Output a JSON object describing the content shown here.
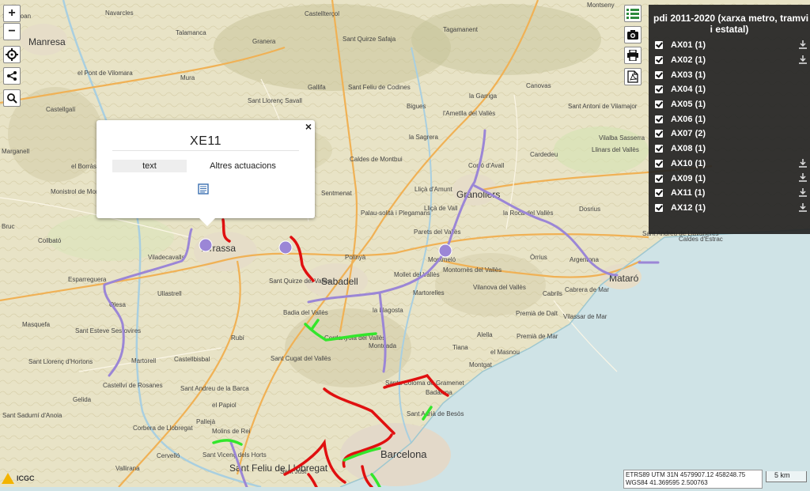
{
  "zoom": {
    "in_label": "+",
    "out_label": "−"
  },
  "panel": {
    "title_line1": "pdi 2011-2020 (xarxa metro, tramvi",
    "title_line2": "i estatal)",
    "layers": [
      {
        "label": "AX01 (1)",
        "download": true
      },
      {
        "label": "AX02 (1)",
        "download": true
      },
      {
        "label": "AX03 (1)",
        "download": false
      },
      {
        "label": "AX04 (1)",
        "download": false
      },
      {
        "label": "AX05 (1)",
        "download": false
      },
      {
        "label": "AX06 (1)",
        "download": false
      },
      {
        "label": "AX07 (2)",
        "download": false
      },
      {
        "label": "AX08 (1)",
        "download": false
      },
      {
        "label": "AX10 (1)",
        "download": true
      },
      {
        "label": "AX09 (1)",
        "download": true
      },
      {
        "label": "AX11 (1)",
        "download": true
      },
      {
        "label": "AX12 (1)",
        "download": true
      }
    ]
  },
  "popup": {
    "title": "XE11",
    "close": "×",
    "tab_text": "text",
    "tab_other": "Altres actuacions"
  },
  "coords": {
    "line1": "ETRS89 UTM 31N 4579907.12 458248.75",
    "line2": "WGS84 41.369595 2.500763"
  },
  "scale": "5 km",
  "logo": "ICGC",
  "colors": {
    "purple": "#9b86d6",
    "red": "#e01010",
    "green": "#33e62c",
    "sea": "#cfe3e6",
    "land": "#e9e4c7"
  },
  "places": [
    {
      "name": "Sant Joan"
    },
    {
      "name": "Manresa"
    },
    {
      "name": "Navarcles"
    },
    {
      "name": "Talamanca"
    },
    {
      "name": "Granera"
    },
    {
      "name": "Castellterçol"
    },
    {
      "name": "Sant Quirze Safaja"
    },
    {
      "name": "Tagamanent"
    },
    {
      "name": "Montseny"
    },
    {
      "name": "el Pont de Vilomara"
    },
    {
      "name": "Mura"
    },
    {
      "name": "Gallifa"
    },
    {
      "name": "Sant Feliu de Codines"
    },
    {
      "name": "Canovas"
    },
    {
      "name": "Castellgalí"
    },
    {
      "name": "Sant Llorenç Savall"
    },
    {
      "name": "Bigues"
    },
    {
      "name": "l'Ametlla del Vallès"
    },
    {
      "name": "la Garriga"
    },
    {
      "name": "Sant Antoni de Vilamajor"
    },
    {
      "name": "Marganell"
    },
    {
      "name": "Caldes de Montbui"
    },
    {
      "name": "la Sagrera"
    },
    {
      "name": "Cardedeu"
    },
    {
      "name": "Llinars del Vallès"
    },
    {
      "name": "Vilalba Sasserra"
    },
    {
      "name": "el Borràs"
    },
    {
      "name": "Monistrol de Montserrat"
    },
    {
      "name": "Sentmenat"
    },
    {
      "name": "Lliçà d'Amunt"
    },
    {
      "name": "Corró d'Avall"
    },
    {
      "name": "Granollers"
    },
    {
      "name": "Palau-solità i Plegamans"
    },
    {
      "name": "Lliçà de Vall"
    },
    {
      "name": "la Roca del Vallès"
    },
    {
      "name": "Dosrius"
    },
    {
      "name": "Bruc"
    },
    {
      "name": "Collbató"
    },
    {
      "name": "Parets del Vallès"
    },
    {
      "name": "Sant Andreu de Llavaneres"
    },
    {
      "name": "Caldes d'Estrac"
    },
    {
      "name": "Viladecavalls"
    },
    {
      "name": "Terrassa"
    },
    {
      "name": "Polinyà"
    },
    {
      "name": "Montmeló"
    },
    {
      "name": "Montornès del Vallès"
    },
    {
      "name": "Òrrius"
    },
    {
      "name": "Argentona"
    },
    {
      "name": "Mataró"
    },
    {
      "name": "Esparreguera"
    },
    {
      "name": "Sant Quirze del Vallès"
    },
    {
      "name": "Sabadell"
    },
    {
      "name": "Mollet del Vallès"
    },
    {
      "name": "Vilanova del Vallès"
    },
    {
      "name": "Ullastrell"
    },
    {
      "name": "Olesa"
    },
    {
      "name": "Martorelles"
    },
    {
      "name": "Cabrils"
    },
    {
      "name": "Cabrera de Mar"
    },
    {
      "name": "Badia del Vallès"
    },
    {
      "name": "la Llagosta"
    },
    {
      "name": "Premià de Dalt"
    },
    {
      "name": "Vilassar de Mar"
    },
    {
      "name": "Masquefa"
    },
    {
      "name": "Sant Esteve Sesrovires"
    },
    {
      "name": "Rubí"
    },
    {
      "name": "Cerdanyola del Vallès"
    },
    {
      "name": "Montcada"
    },
    {
      "name": "Alella"
    },
    {
      "name": "Premià de Mar"
    },
    {
      "name": "Tiana"
    },
    {
      "name": "el Masnou"
    },
    {
      "name": "Sant Llorenç d'Hortons"
    },
    {
      "name": "Martorell"
    },
    {
      "name": "Castellbisbal"
    },
    {
      "name": "Sant Cugat del Vallès"
    },
    {
      "name": "Montgat"
    },
    {
      "name": "Castellví de Rosanes"
    },
    {
      "name": "Sant Andreu de la Barca"
    },
    {
      "name": "Santa Coloma de Gramenet"
    },
    {
      "name": "Badalona"
    },
    {
      "name": "Gelida"
    },
    {
      "name": "el Papiol"
    },
    {
      "name": "Sant Adrià de Besòs"
    },
    {
      "name": "Sant Sadurní d'Anoia"
    },
    {
      "name": "Corbera de Llobregat"
    },
    {
      "name": "Pallejà"
    },
    {
      "name": "Molins de Rei"
    },
    {
      "name": "Cervelló"
    },
    {
      "name": "Sant Vicenç dels Horts"
    },
    {
      "name": "Sant Feliu de Llobregat"
    },
    {
      "name": "Barcelona"
    },
    {
      "name": "Vallirana"
    },
    {
      "name": "Sant Just"
    }
  ]
}
